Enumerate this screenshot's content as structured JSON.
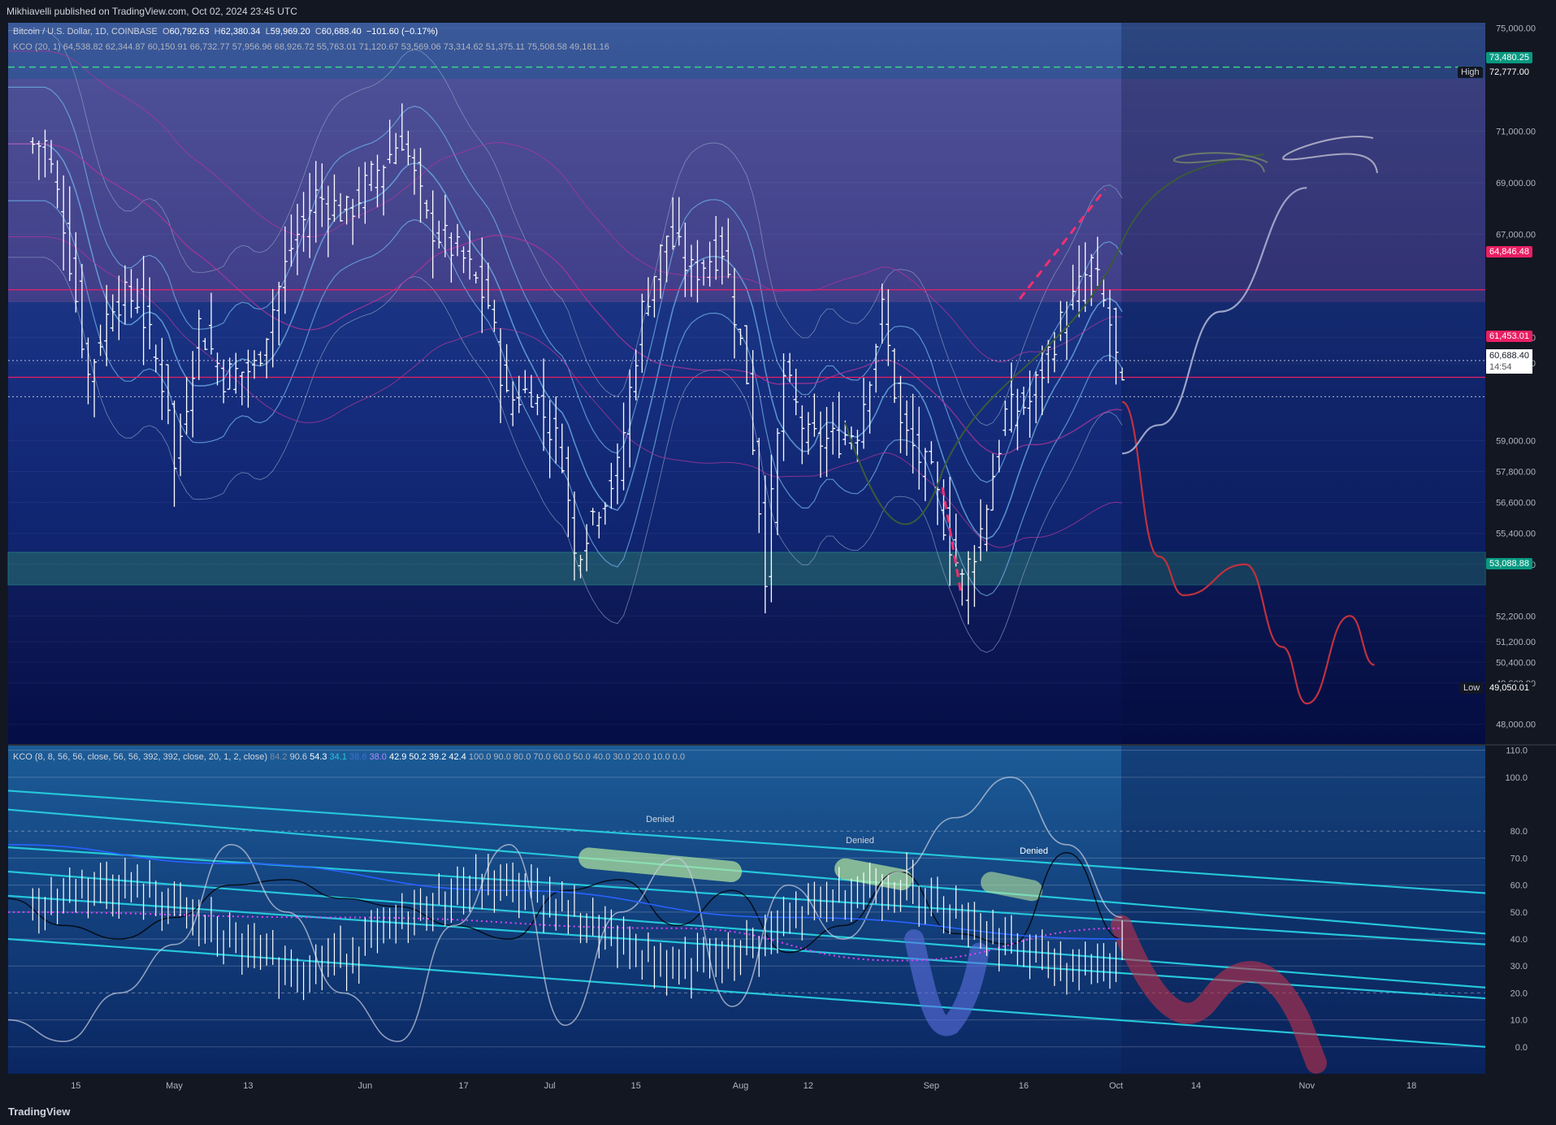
{
  "header": {
    "publisher": "Mikhiavelli published on TradingView.com, Oct 02, 2024 23:45 UTC"
  },
  "legend_main": {
    "symbol": "Bitcoin / U.S. Dollar, 1D, COINBASE",
    "open_label": "O",
    "open": "60,792.63",
    "high_label": "H",
    "high": "62,380.34",
    "low_label": "L",
    "low": "59,969.20",
    "close_label": "C",
    "close": "60,688.40",
    "change": "−101.60 (−0.17%)"
  },
  "legend_kco": {
    "name": "KCO (20, 1)",
    "values": [
      "64,538.82",
      "62,344.87",
      "60,150.91",
      "66,732.77",
      "57,956.96",
      "68,926.72",
      "55,763.01",
      "71,120.67",
      "53,569.06",
      "73,314.62",
      "51,375.11",
      "75,508.58",
      "49,181.16"
    ]
  },
  "legend_osc": {
    "name": "KCO (8, 8, 56, 56, close, 56, 56, 392, 392, close, 20, 1, 2, close)",
    "values": [
      "84.2",
      "90.6",
      "54.3",
      "34.1",
      "38.6",
      "38.0",
      "42.9",
      "50.2",
      "39.2",
      "42.4",
      "100.0",
      "90.0",
      "80.0",
      "70.0",
      "60.0",
      "50.0",
      "40.0",
      "30.0",
      "20.0",
      "10.0",
      "0.0"
    ]
  },
  "price_labels": {
    "dashed_green": "73,480.25",
    "high_label": "High",
    "high_value": "72,777.00",
    "resistance": "64,846.48",
    "mid": "61,453.01",
    "current": "60,688.40",
    "countdown": "14:54",
    "support": "53,088.88",
    "low_label": "Low",
    "low_value": "49,050.01"
  },
  "colors": {
    "background": "#131722",
    "up_candle": "#ffffff",
    "cyan": "#26c6da",
    "red_path": "#c0313f",
    "resistance_tag": "#e91e63",
    "support_tag": "#089981"
  },
  "annotations": {
    "denied_1": "Denied",
    "denied_2": "Denied",
    "denied_3": "Denied"
  },
  "footer": {
    "brand": "TradingView"
  },
  "chart_data": [
    {
      "type": "candlestick",
      "title": "Bitcoin / U.S. Dollar, 1D, COINBASE",
      "ylim": [
        47200,
        75200
      ],
      "yticks": [
        "75,000.00",
        "71,000.00",
        "69,000.00",
        "67,000.00",
        "63,000.00",
        "62,000.00",
        "59,000.00",
        "57,800.00",
        "56,600.00",
        "55,400.00",
        "54,200.00",
        "52,200.00",
        "51,200.00",
        "50,400.00",
        "49,600.00",
        "48,000.00"
      ],
      "ytick_values": [
        75000,
        71000,
        69000,
        67000,
        63000,
        62000,
        59000,
        57800,
        56600,
        55400,
        54200,
        52200,
        51200,
        50400,
        49600,
        48000
      ],
      "xticks": [
        "15",
        "May",
        "13",
        "Jun",
        "17",
        "Jul",
        "15",
        "Aug",
        "12",
        "Sep",
        "16",
        "Oct",
        "14",
        "Nov",
        "18"
      ],
      "close_path": [
        [
          "2024-04-10",
          70500
        ],
        [
          "2024-04-13",
          67500
        ],
        [
          "2024-04-17",
          61500
        ],
        [
          "2024-04-21",
          64500
        ],
        [
          "2024-04-25",
          64500
        ],
        [
          "2024-04-30",
          60500
        ],
        [
          "2024-05-01",
          57800
        ],
        [
          "2024-05-05",
          63500
        ],
        [
          "2024-05-09",
          61500
        ],
        [
          "2024-05-14",
          61800
        ],
        [
          "2024-05-20",
          66500
        ],
        [
          "2024-05-24",
          68500
        ],
        [
          "2024-05-29",
          67800
        ],
        [
          "2024-06-03",
          69500
        ],
        [
          "2024-06-07",
          70800
        ],
        [
          "2024-06-11",
          67500
        ],
        [
          "2024-06-17",
          66000
        ],
        [
          "2024-06-21",
          64300
        ],
        [
          "2024-06-24",
          60500
        ],
        [
          "2024-06-28",
          61000
        ],
        [
          "2024-07-03",
          58500
        ],
        [
          "2024-07-05",
          54500
        ],
        [
          "2024-07-08",
          56200
        ],
        [
          "2024-07-12",
          57800
        ],
        [
          "2024-07-16",
          64000
        ],
        [
          "2024-07-20",
          67000
        ],
        [
          "2024-07-24",
          65500
        ],
        [
          "2024-07-29",
          66500
        ],
        [
          "2024-08-02",
          61500
        ],
        [
          "2024-08-05",
          54000
        ],
        [
          "2024-08-08",
          61500
        ],
        [
          "2024-08-12",
          59000
        ],
        [
          "2024-08-16",
          59000
        ],
        [
          "2024-08-20",
          59500
        ],
        [
          "2024-08-24",
          64000
        ],
        [
          "2024-08-27",
          59500
        ],
        [
          "2024-09-01",
          57500
        ],
        [
          "2024-09-06",
          53500
        ],
        [
          "2024-09-09",
          55500
        ],
        [
          "2024-09-13",
          60000
        ],
        [
          "2024-09-17",
          60500
        ],
        [
          "2024-09-21",
          63000
        ],
        [
          "2024-09-27",
          65800
        ],
        [
          "2024-09-30",
          63500
        ],
        [
          "2024-10-02",
          60688
        ]
      ],
      "horizontal_levels": [
        73480.25,
        64846.48,
        61453.01,
        53088.88
      ],
      "projections": [
        {
          "color": "red",
          "points": [
            [
              "2024-10-02",
              60500
            ],
            [
              "2024-10-08",
              54500
            ],
            [
              "2024-10-12",
              53000
            ],
            [
              "2024-10-22",
              54200
            ],
            [
              "2024-10-28",
              51000
            ],
            [
              "2024-11-01",
              48800
            ],
            [
              "2024-11-08",
              52200
            ],
            [
              "2024-11-12",
              50300
            ]
          ]
        },
        {
          "color": "grey",
          "points": [
            [
              "2024-10-02",
              58500
            ],
            [
              "2024-10-08",
              59600
            ],
            [
              "2024-10-18",
              64000
            ],
            [
              "2024-11-01",
              68800
            ]
          ]
        }
      ]
    },
    {
      "type": "line",
      "title": "KCO (8, 8, 56, 56, close, 56, 56, 392, 392, close, 20, 1, 2, close)",
      "ylim": [
        -10,
        112
      ],
      "yticks": [
        "110.0",
        "100.0",
        "80.0",
        "70.0",
        "60.0",
        "50.0",
        "40.0",
        "30.0",
        "20.0",
        "10.0",
        "0.0"
      ],
      "ytick_values": [
        110,
        100,
        80,
        70,
        60,
        50,
        40,
        30,
        20,
        10,
        0
      ],
      "series": [
        {
          "values": [
            [
              0,
              55
            ],
            [
              0.05,
              45
            ],
            [
              0.1,
              40
            ],
            [
              0.15,
              48
            ],
            [
              0.2,
              60
            ],
            [
              0.25,
              62
            ],
            [
              0.3,
              55
            ],
            [
              0.35,
              52
            ],
            [
              0.4,
              45
            ],
            [
              0.45,
              40
            ],
            [
              0.5,
              58
            ],
            [
              0.55,
              62
            ],
            [
              0.6,
              45
            ],
            [
              0.65,
              58
            ],
            [
              0.7,
              35
            ],
            [
              0.75,
              45
            ],
            [
              0.8,
              65
            ],
            [
              0.85,
              42
            ],
            [
              0.9,
              38
            ],
            [
              0.95,
              72
            ],
            [
              1,
              40
            ]
          ]
        },
        {
          "values": [
            [
              0,
              10
            ],
            [
              0.05,
              2
            ],
            [
              0.1,
              20
            ],
            [
              0.15,
              38
            ],
            [
              0.2,
              75
            ],
            [
              0.25,
              50
            ],
            [
              0.3,
              20
            ],
            [
              0.35,
              2
            ],
            [
              0.4,
              45
            ],
            [
              0.45,
              75
            ],
            [
              0.5,
              8
            ],
            [
              0.55,
              50
            ],
            [
              0.6,
              70
            ],
            [
              0.65,
              15
            ],
            [
              0.7,
              60
            ],
            [
              0.75,
              40
            ],
            [
              0.8,
              65
            ],
            [
              0.85,
              85
            ],
            [
              0.9,
              100
            ],
            [
              0.95,
              75
            ],
            [
              1,
              48
            ]
          ]
        }
      ]
    }
  ]
}
